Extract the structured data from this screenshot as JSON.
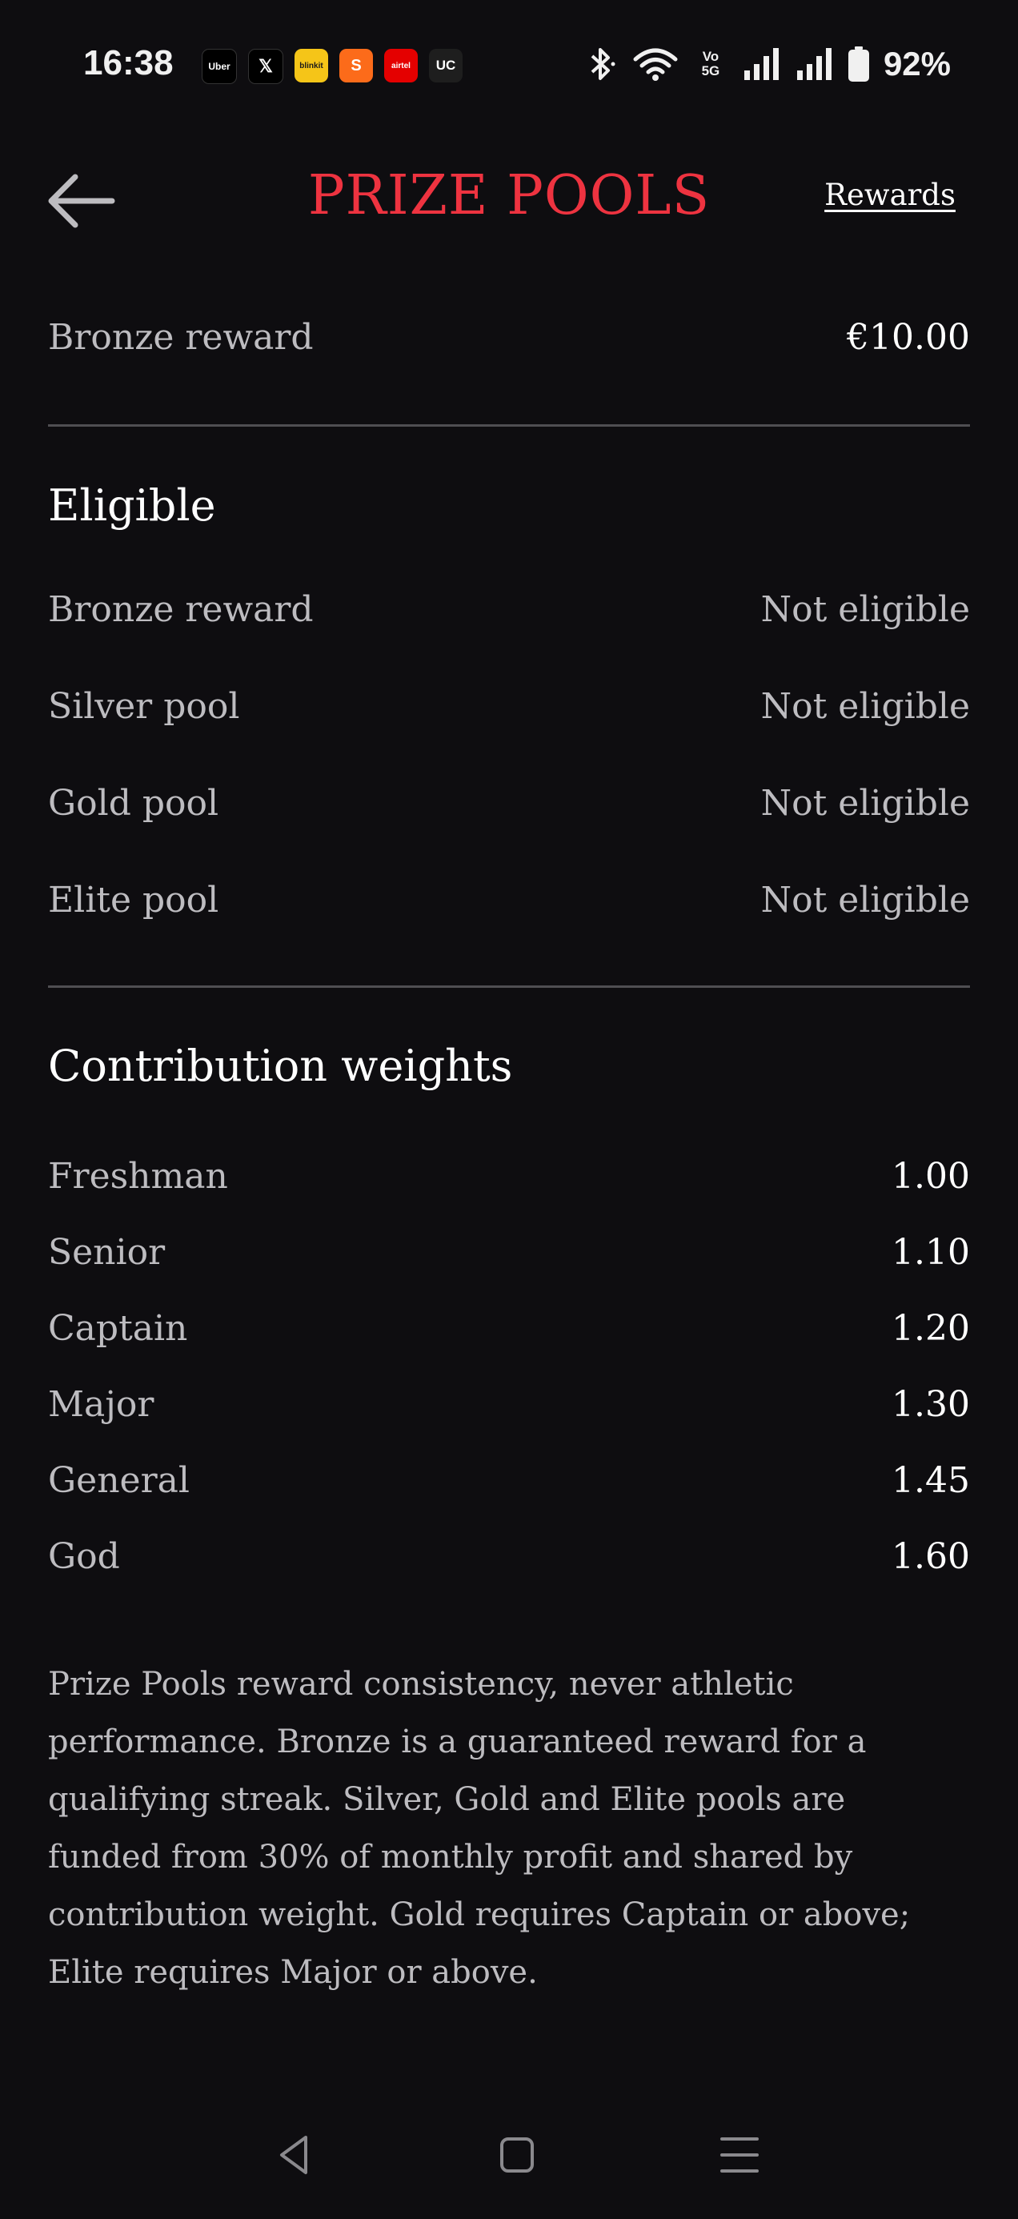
{
  "status_bar": {
    "time": "16:38",
    "apps": [
      {
        "name": "uber-icon",
        "label": "Uber",
        "color": "#000000"
      },
      {
        "name": "x-icon",
        "label": "𝕏",
        "color": "#000000"
      },
      {
        "name": "blinkit-icon",
        "label": "blinkit",
        "color": "#f5c518"
      },
      {
        "name": "swiggy-icon",
        "label": "S",
        "color": "#fc6b1a"
      },
      {
        "name": "airtel-icon",
        "label": "airtel",
        "color": "#e40000"
      },
      {
        "name": "uc-icon",
        "label": "UC",
        "color": "#1e1e1e"
      }
    ],
    "network_label": "Vo 5G",
    "battery": "92%"
  },
  "header": {
    "title": "PRIZE POOLS",
    "rewards_link": "Rewards",
    "title_color": "#ee3340"
  },
  "summary": {
    "label": "Bronze reward",
    "value": "€10.00"
  },
  "eligible": {
    "title": "Eligible",
    "items": [
      {
        "label": "Bronze reward",
        "value": "Not eligible"
      },
      {
        "label": "Silver pool",
        "value": "Not eligible"
      },
      {
        "label": "Gold pool",
        "value": "Not eligible"
      },
      {
        "label": "Elite pool",
        "value": "Not eligible"
      }
    ]
  },
  "weights": {
    "title": "Contribution weights",
    "items": [
      {
        "label": "Freshman",
        "value": "1.00"
      },
      {
        "label": "Senior",
        "value": "1.10"
      },
      {
        "label": "Captain",
        "value": "1.20"
      },
      {
        "label": "Major",
        "value": "1.30"
      },
      {
        "label": "General",
        "value": "1.45"
      },
      {
        "label": "God",
        "value": "1.60"
      }
    ]
  },
  "description": "Prize Pools reward consistency, never athletic performance. Bronze is a guaranteed reward for a qualifying streak. Silver, Gold and Elite pools are funded from 30% of monthly profit and shared by contribution weight. Gold requires Captain or above; Elite requires Major or above."
}
